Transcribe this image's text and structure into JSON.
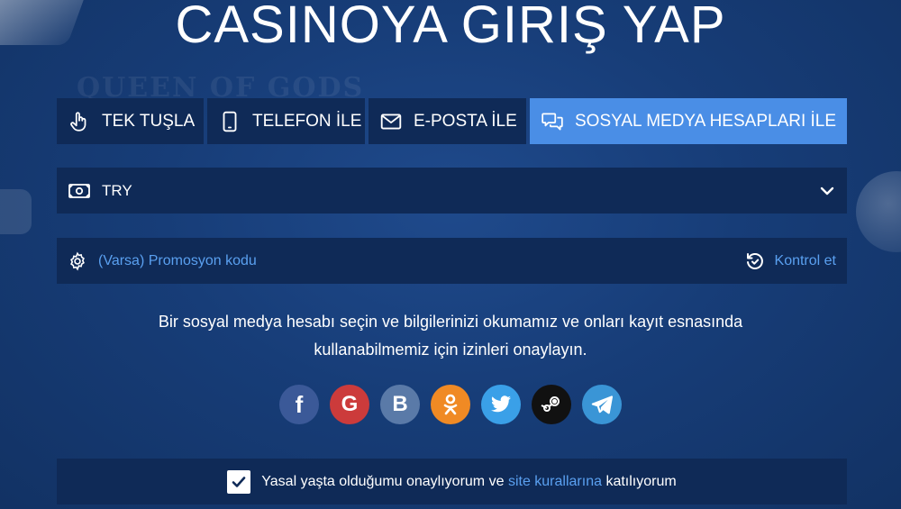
{
  "title": "CASINOYA GIRIŞ YAP",
  "tabs": [
    {
      "label": "TEK TUŞLA",
      "icon": "hand-pointer-icon",
      "active": false
    },
    {
      "label": "TELEFON İLE",
      "icon": "phone-icon",
      "active": false
    },
    {
      "label": "E-POSTA İLE",
      "icon": "envelope-icon",
      "active": false
    },
    {
      "label": "SOSYAL MEDYA HESAPLARI İLE",
      "icon": "chat-bubbles-icon",
      "active": true
    }
  ],
  "currency": {
    "value": "TRY",
    "icon": "banknote-icon"
  },
  "promo": {
    "placeholder": "(Varsa) Promosyon kodu",
    "check_label": "Kontrol et"
  },
  "description": {
    "line1": "Bir sosyal medya hesabı seçin ve bilgilerinizi okumamız ve onları kayıt esnasında",
    "line2": "kullanabilmemiz için izinleri onaylayın."
  },
  "socials": [
    {
      "name": "facebook",
      "glyph": "f",
      "color": "#3b5998"
    },
    {
      "name": "google",
      "glyph": "G",
      "color": "#cc3b3b"
    },
    {
      "name": "vkontakte",
      "glyph": "B",
      "color": "#5a7aa8"
    },
    {
      "name": "odnoklassniki",
      "glyph": "",
      "color": "#f08a24"
    },
    {
      "name": "twitter",
      "glyph": "",
      "color": "#3aa0e8"
    },
    {
      "name": "steam",
      "glyph": "",
      "color": "#111111"
    },
    {
      "name": "telegram",
      "glyph": "",
      "color": "#3a95d6"
    }
  ],
  "terms": {
    "prefix": "Yasal yaşta olduğumu onaylıyorum ve",
    "link": "site kurallarına",
    "suffix": "katılıyorum",
    "checked": true
  },
  "colors": {
    "background": "#173d78",
    "panel": "#0f2a57",
    "accent": "#4a8ee6",
    "link": "#5aa0f0"
  },
  "background_watermark": "QUEEN OF GODS"
}
